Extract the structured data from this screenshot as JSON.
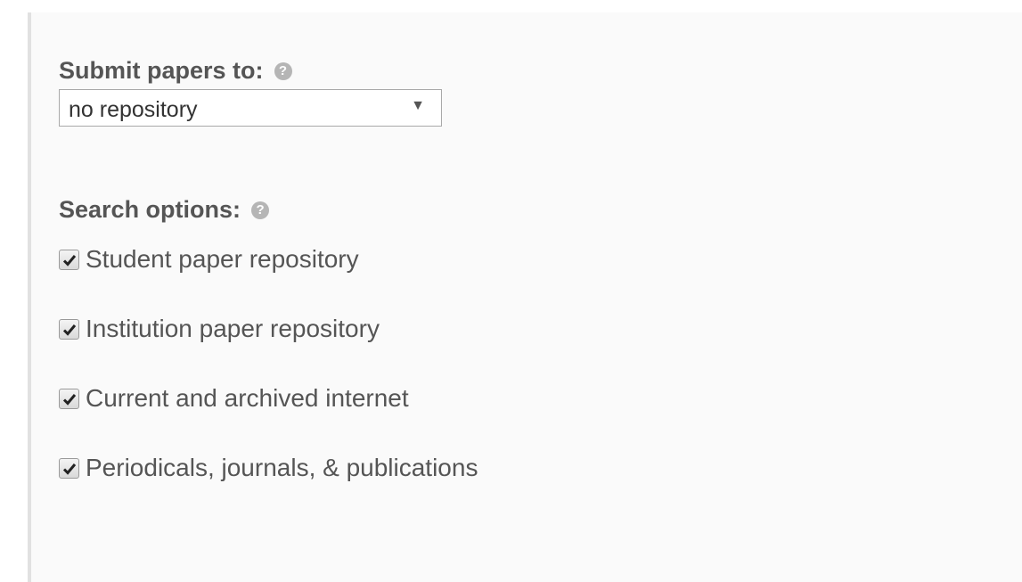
{
  "submit": {
    "label": "Submit papers to:",
    "help_icon": "?",
    "selected": "no repository",
    "arrow": "▼"
  },
  "search": {
    "label": "Search options:",
    "help_icon": "?",
    "options": [
      {
        "label": "Student paper repository",
        "checked": true
      },
      {
        "label": "Institution paper repository",
        "checked": true
      },
      {
        "label": "Current and archived internet",
        "checked": true
      },
      {
        "label": "Periodicals, journals, & publications",
        "checked": true
      }
    ]
  },
  "colors": {
    "panel_background": "#fafafa",
    "label_text": "#555555",
    "help_icon": "#b5b5b5",
    "border": "#a9a9a9"
  }
}
